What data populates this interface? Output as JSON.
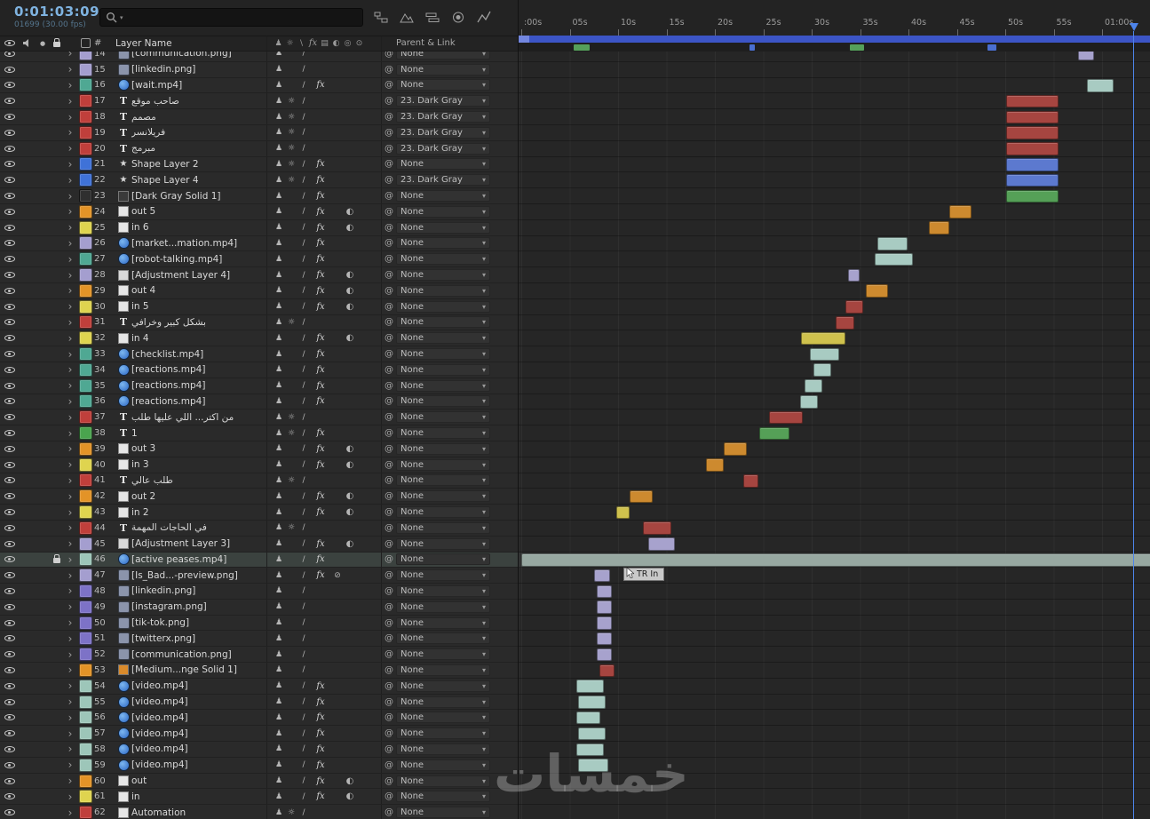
{
  "app": {
    "name": "After Effects Timeline"
  },
  "toolbar": {
    "timecode": "0:01:03:09",
    "frame_info": "01699 (30.00 fps)",
    "search_placeholder": ""
  },
  "header": {
    "number": "#",
    "layer_name": "Layer Name",
    "parent_link": "Parent & Link"
  },
  "glyphs": {
    "arrow": "›",
    "at": "@",
    "caret": "▾",
    "solo": "●",
    "shy": "♟",
    "collapse": "☼",
    "quality": "/",
    "fx": "fx",
    "frame_blend": "⊘",
    "motion_blur": "◐",
    "hdr_quality": "\\",
    "hdr_frame_blend": "▤",
    "hdr_adjustment": "◎",
    "hdr_3d": "⊙",
    "type_text": "T",
    "type_shape": "★"
  },
  "ruler": {
    "ticks": [
      ":00s",
      "05s",
      "10s",
      "15s",
      "20s",
      "25s",
      "30s",
      "35s",
      "40s",
      "45s",
      "50s",
      "55s",
      "01:00s"
    ],
    "seconds_per_tick": 5
  },
  "playhead": {
    "time_sec": 63.3
  },
  "tooltip": {
    "text": "TR In"
  },
  "watermark": "خمسات",
  "colors": {
    "chip": {
      "lavender": "#a49ecf",
      "purple": "#7d72c7",
      "teal": "#4fa893",
      "seafoam": "#9dc6b9",
      "red": "#c03f3b",
      "yellow": "#dfd44f",
      "orange": "#e39327",
      "blue": "#3f72d8",
      "green": "#4aa44e",
      "dark": "#2f2f2f"
    },
    "bar": {
      "red": "#a64540",
      "blue": "#5c79cf",
      "green": "#55a057",
      "orange": "#cd8a2f",
      "yellow": "#cfc14d",
      "teal": "#a8cbc2",
      "lavender": "#a7a2cd",
      "sel": "#97a8a1"
    },
    "work_area": "#3c55c6",
    "timecode": "#7fb3e0"
  },
  "markers": [
    {
      "t": 5.4,
      "d": 1.7,
      "c": "#55a05a"
    },
    {
      "t": 23.6,
      "d": 0.5,
      "c": "#4a6fd0"
    },
    {
      "t": 33.9,
      "d": 1.5,
      "c": "#55a05a"
    },
    {
      "t": 48.2,
      "d": 0.9,
      "c": "#4a6fd0"
    }
  ],
  "layers": [
    {
      "num": 14,
      "name": "[communication.png]",
      "type": "img",
      "chip": "lavender",
      "sw": "sq",
      "parent": "None",
      "bar": {
        "t": 57.5,
        "d": 1.7,
        "c": "lavender"
      }
    },
    {
      "num": 15,
      "name": "[linkedin.png]",
      "type": "img",
      "chip": "lavender",
      "sw": "sq",
      "parent": "None",
      "bar": null
    },
    {
      "num": 16,
      "name": "[wait.mp4]",
      "type": "video",
      "chip": "teal",
      "sw": "sqf",
      "parent": "None",
      "bar": {
        "t": 58.4,
        "d": 2.8,
        "c": "teal"
      }
    },
    {
      "num": 17,
      "name": "صاحب موقع",
      "type": "text",
      "chip": "red",
      "sw": "scq",
      "parent": "23. Dark Gray",
      "bar": {
        "t": 50.1,
        "d": 5.4,
        "c": "red"
      }
    },
    {
      "num": 18,
      "name": "مصمم",
      "type": "text",
      "chip": "red",
      "sw": "scq",
      "parent": "23. Dark Gray",
      "bar": {
        "t": 50.1,
        "d": 5.4,
        "c": "red"
      }
    },
    {
      "num": 19,
      "name": "فريلانسر",
      "type": "text",
      "chip": "red",
      "sw": "scq",
      "parent": "23. Dark Gray",
      "bar": {
        "t": 50.1,
        "d": 5.4,
        "c": "red"
      }
    },
    {
      "num": 20,
      "name": "مبرمج",
      "type": "text",
      "chip": "red",
      "sw": "scq",
      "parent": "23. Dark Gray",
      "bar": {
        "t": 50.1,
        "d": 5.4,
        "c": "red"
      }
    },
    {
      "num": 21,
      "name": "Shape Layer 2",
      "type": "shape",
      "chip": "blue",
      "sw": "scqf",
      "parent": "None",
      "bar": {
        "t": 50.1,
        "d": 5.4,
        "c": "blue"
      }
    },
    {
      "num": 22,
      "name": "Shape Layer 4",
      "type": "shape",
      "chip": "blue",
      "sw": "scqf",
      "parent": "23. Dark Gray",
      "bar": {
        "t": 50.1,
        "d": 5.4,
        "c": "blue"
      }
    },
    {
      "num": 23,
      "name": "[Dark Gray Solid 1]",
      "type": "solid-dark",
      "chip": "dark",
      "sw": "sqf",
      "parent": "None",
      "bar": {
        "t": 50.1,
        "d": 5.4,
        "c": "green"
      }
    },
    {
      "num": 24,
      "name": "out 5",
      "type": "comp",
      "chip": "orange",
      "sw": "sqfm",
      "parent": "None",
      "bar": {
        "t": 44.2,
        "d": 2.3,
        "c": "orange"
      }
    },
    {
      "num": 25,
      "name": "in 6",
      "type": "comp",
      "chip": "yellow",
      "sw": "sqfm",
      "parent": "None",
      "bar": {
        "t": 42.1,
        "d": 2.1,
        "c": "orange"
      }
    },
    {
      "num": 26,
      "name": "[market...mation.mp4]",
      "type": "video",
      "chip": "lavender",
      "sw": "sqf",
      "parent": "None",
      "bar": {
        "t": 36.8,
        "d": 3.1,
        "c": "teal"
      }
    },
    {
      "num": 27,
      "name": "[robot-talking.mp4]",
      "type": "video",
      "chip": "teal",
      "sw": "sqf",
      "parent": "None",
      "bar": {
        "t": 36.5,
        "d": 4.0,
        "c": "teal"
      }
    },
    {
      "num": 28,
      "name": "[Adjustment Layer 4]",
      "type": "adj",
      "chip": "lavender",
      "sw": "sqfm",
      "parent": "None",
      "bar": {
        "t": 33.8,
        "d": 1.2,
        "c": "lavender"
      }
    },
    {
      "num": 29,
      "name": "out 4",
      "type": "comp",
      "chip": "orange",
      "sw": "sqfm",
      "parent": "None",
      "bar": {
        "t": 35.6,
        "d": 2.3,
        "c": "orange"
      }
    },
    {
      "num": 30,
      "name": "in 5",
      "type": "comp",
      "chip": "yellow",
      "sw": "sqfm",
      "parent": "None",
      "bar": {
        "t": 33.5,
        "d": 1.8,
        "c": "red"
      }
    },
    {
      "num": 31,
      "name": "بشكل كبير وخرافي",
      "type": "text",
      "chip": "red",
      "sw": "scq",
      "parent": "None",
      "bar": {
        "t": 32.5,
        "d": 1.9,
        "c": "red"
      }
    },
    {
      "num": 32,
      "name": "in 4",
      "type": "comp",
      "chip": "yellow",
      "sw": "sqfm",
      "parent": "None",
      "bar": {
        "t": 28.9,
        "d": 4.6,
        "c": "yellow"
      }
    },
    {
      "num": 33,
      "name": "[checklist.mp4]",
      "type": "video",
      "chip": "teal",
      "sw": "sqf",
      "parent": "None",
      "bar": {
        "t": 29.8,
        "d": 3.0,
        "c": "teal"
      }
    },
    {
      "num": 34,
      "name": "[reactions.mp4]",
      "type": "video",
      "chip": "teal",
      "sw": "sqf",
      "parent": "None",
      "bar": {
        "t": 30.2,
        "d": 1.8,
        "c": "teal"
      }
    },
    {
      "num": 35,
      "name": "[reactions.mp4]",
      "type": "video",
      "chip": "teal",
      "sw": "sqf",
      "parent": "None",
      "bar": {
        "t": 29.3,
        "d": 1.8,
        "c": "teal"
      }
    },
    {
      "num": 36,
      "name": "[reactions.mp4]",
      "type": "video",
      "chip": "teal",
      "sw": "sqf",
      "parent": "None",
      "bar": {
        "t": 28.8,
        "d": 1.8,
        "c": "teal"
      }
    },
    {
      "num": 37,
      "name": "من اكتر... اللي عليها طلب",
      "type": "text",
      "chip": "red",
      "sw": "scq",
      "parent": "None",
      "bar": {
        "t": 25.6,
        "d": 3.5,
        "c": "red"
      }
    },
    {
      "num": 38,
      "name": "1",
      "type": "text",
      "chip": "green",
      "sw": "scqf",
      "parent": "None",
      "bar": {
        "t": 24.6,
        "d": 3.1,
        "c": "green"
      }
    },
    {
      "num": 39,
      "name": "out 3",
      "type": "comp",
      "chip": "orange",
      "sw": "sqfm",
      "parent": "None",
      "bar": {
        "t": 20.9,
        "d": 2.4,
        "c": "orange"
      }
    },
    {
      "num": 40,
      "name": "in 3",
      "type": "comp",
      "chip": "yellow",
      "sw": "sqfm",
      "parent": "None",
      "bar": {
        "t": 19.1,
        "d": 1.8,
        "c": "orange"
      }
    },
    {
      "num": 41,
      "name": "طلب عالي",
      "type": "text",
      "chip": "red",
      "sw": "scq",
      "parent": "None",
      "bar": {
        "t": 22.9,
        "d": 1.6,
        "c": "red"
      }
    },
    {
      "num": 42,
      "name": "out 2",
      "type": "comp",
      "chip": "orange",
      "sw": "sqfm",
      "parent": "None",
      "bar": {
        "t": 11.2,
        "d": 2.4,
        "c": "orange"
      }
    },
    {
      "num": 43,
      "name": "in 2",
      "type": "comp",
      "chip": "yellow",
      "sw": "sqfm",
      "parent": "None",
      "bar": {
        "t": 9.8,
        "d": 1.4,
        "c": "yellow"
      }
    },
    {
      "num": 44,
      "name": "في الحاجات المهمة",
      "type": "text",
      "chip": "red",
      "sw": "scq",
      "parent": "None",
      "bar": {
        "t": 12.6,
        "d": 2.9,
        "c": "red"
      }
    },
    {
      "num": 45,
      "name": "[Adjustment Layer 3]",
      "type": "adj",
      "chip": "lavender",
      "sw": "sqfm",
      "parent": "None",
      "bar": {
        "t": 13.1,
        "d": 2.8,
        "c": "lavender"
      }
    },
    {
      "num": 46,
      "name": "[active peases.mp4]",
      "type": "video",
      "chip": "seafoam",
      "sw": "sqf",
      "parent": "None",
      "locked": true,
      "selected": true,
      "bar": {
        "t": 0,
        "d": 66,
        "c": "sel"
      }
    },
    {
      "num": 47,
      "name": "[Is_Bad...-preview.png]",
      "type": "img",
      "chip": "lavender",
      "sw": "sqfb",
      "parent": "None",
      "bar": {
        "t": 7.5,
        "d": 1.7,
        "c": "lavender"
      }
    },
    {
      "num": 48,
      "name": "[linkedin.png]",
      "type": "img",
      "chip": "purple",
      "sw": "sq",
      "parent": "None",
      "bar": {
        "t": 7.8,
        "d": 1.6,
        "c": "lavender"
      }
    },
    {
      "num": 49,
      "name": "[instagram.png]",
      "type": "img",
      "chip": "purple",
      "sw": "sq",
      "parent": "None",
      "bar": {
        "t": 7.8,
        "d": 1.6,
        "c": "lavender"
      }
    },
    {
      "num": 50,
      "name": "[tik-tok.png]",
      "type": "img",
      "chip": "purple",
      "sw": "sq",
      "parent": "None",
      "bar": {
        "t": 7.8,
        "d": 1.6,
        "c": "lavender"
      }
    },
    {
      "num": 51,
      "name": "[twitterx.png]",
      "type": "img",
      "chip": "purple",
      "sw": "sq",
      "parent": "None",
      "bar": {
        "t": 7.8,
        "d": 1.6,
        "c": "lavender"
      }
    },
    {
      "num": 52,
      "name": "[communication.png]",
      "type": "img",
      "chip": "purple",
      "sw": "sq",
      "parent": "None",
      "bar": {
        "t": 7.8,
        "d": 1.6,
        "c": "lavender"
      }
    },
    {
      "num": 53,
      "name": "[Medium...nge Solid 1]",
      "type": "solid-orange",
      "chip": "orange",
      "sw": "sq",
      "parent": "None",
      "bar": {
        "t": 8.1,
        "d": 1.5,
        "c": "red"
      }
    },
    {
      "num": 54,
      "name": "[video.mp4]",
      "type": "video",
      "chip": "seafoam",
      "sw": "sqf",
      "parent": "None",
      "bar": {
        "t": 5.7,
        "d": 2.8,
        "c": "teal"
      }
    },
    {
      "num": 55,
      "name": "[video.mp4]",
      "type": "video",
      "chip": "seafoam",
      "sw": "sqf",
      "parent": "None",
      "bar": {
        "t": 5.9,
        "d": 2.8,
        "c": "teal"
      }
    },
    {
      "num": 56,
      "name": "[video.mp4]",
      "type": "video",
      "chip": "seafoam",
      "sw": "sqf",
      "parent": "None",
      "bar": {
        "t": 5.7,
        "d": 2.5,
        "c": "teal"
      }
    },
    {
      "num": 57,
      "name": "[video.mp4]",
      "type": "video",
      "chip": "seafoam",
      "sw": "sqf",
      "parent": "None",
      "bar": {
        "t": 5.9,
        "d": 2.8,
        "c": "teal"
      }
    },
    {
      "num": 58,
      "name": "[video.mp4]",
      "type": "video",
      "chip": "seafoam",
      "sw": "sqf",
      "parent": "None",
      "bar": {
        "t": 5.7,
        "d": 2.8,
        "c": "teal"
      }
    },
    {
      "num": 59,
      "name": "[video.mp4]",
      "type": "video",
      "chip": "seafoam",
      "sw": "sqf",
      "parent": "None",
      "bar": {
        "t": 5.9,
        "d": 3.1,
        "c": "teal"
      }
    },
    {
      "num": 60,
      "name": "out",
      "type": "comp",
      "chip": "orange",
      "sw": "sqfm",
      "parent": "None",
      "bar": null
    },
    {
      "num": 61,
      "name": "in",
      "type": "comp",
      "chip": "yellow",
      "sw": "sqfm",
      "parent": "None",
      "bar": null
    },
    {
      "num": 62,
      "name": "Automation",
      "type": "comp",
      "chip": "red",
      "sw": "scq",
      "parent": "None",
      "bar": null
    }
  ]
}
